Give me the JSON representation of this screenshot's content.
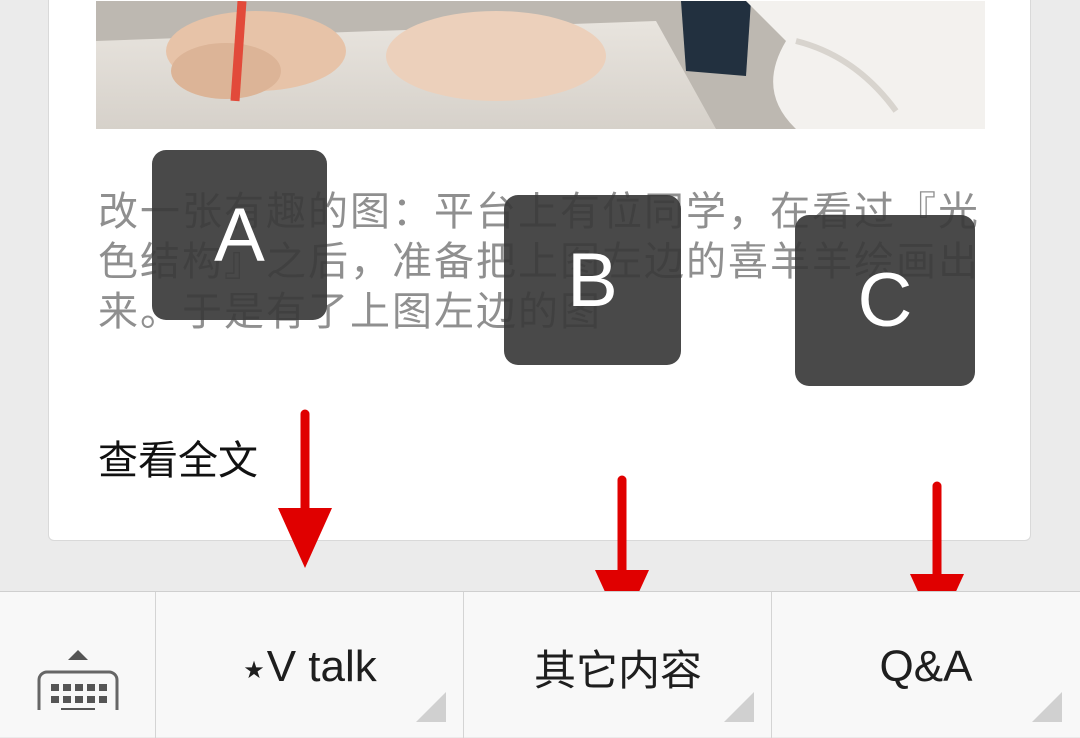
{
  "article": {
    "excerpt": "改一张有趣的图：平台上有位同学，在看过『光色结构』之后，准备把上图左边的喜羊羊绘画出来。于是有了上图左边的图",
    "read_more": "查看全文"
  },
  "annotations": {
    "badge_a": "A",
    "badge_b": "B",
    "badge_c": "C",
    "arrow_color": "#e00000"
  },
  "menu": {
    "keyboard_icon": "keyboard-icon",
    "item1_star": "★",
    "item1_label": "V talk",
    "item2_label": "其它内容",
    "item3_label": "Q&A"
  }
}
